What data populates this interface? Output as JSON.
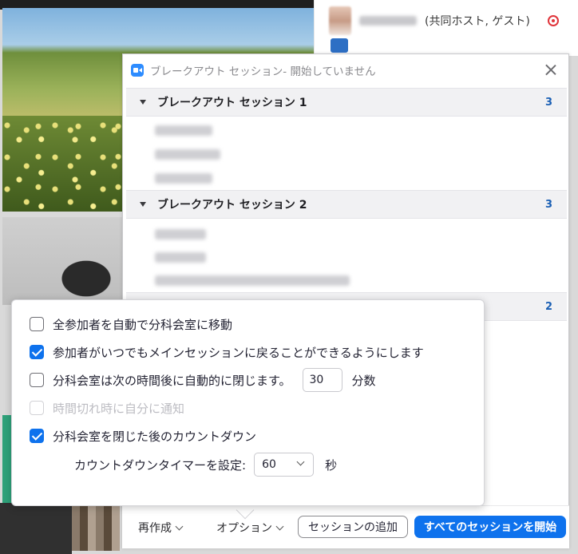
{
  "background": {
    "participant_role": "(共同ホスト, ゲスト)"
  },
  "breakout_window": {
    "title": "ブレークアウト セッション- 開始していません",
    "sessions": [
      {
        "name": "ブレークアウト セッション 1",
        "count": "3"
      },
      {
        "name": "ブレークアウト セッション 2",
        "count": "3"
      },
      {
        "name": "",
        "count": "2"
      }
    ]
  },
  "options_popup": {
    "items": [
      {
        "label": "全参加者を自動で分科会室に移動",
        "checked": false,
        "disabled": false
      },
      {
        "label": "参加者がいつでもメインセッションに戻ることができるようにします",
        "checked": true,
        "disabled": false
      },
      {
        "label": "分科会室は次の時間後に自動的に閉じます。",
        "checked": false,
        "disabled": false
      },
      {
        "label": "時間切れ時に自分に通知",
        "checked": false,
        "disabled": true
      },
      {
        "label": "分科会室を閉じた後のカウントダウン",
        "checked": true,
        "disabled": false
      }
    ],
    "close_after_minutes": "30",
    "minutes_unit": "分数",
    "countdown_label": "カウントダウンタイマーを設定:",
    "countdown_value": "60",
    "seconds_unit": "秒"
  },
  "bottom_bar": {
    "recreate_label": "再作成",
    "options_label": "オプション",
    "add_session_label": "セッションの追加",
    "start_all_label": "すべてのセッションを開始"
  },
  "colors": {
    "accent_blue": "#0e72ed",
    "count_blue": "#1a5fb4",
    "record_red": "#e0343a"
  }
}
